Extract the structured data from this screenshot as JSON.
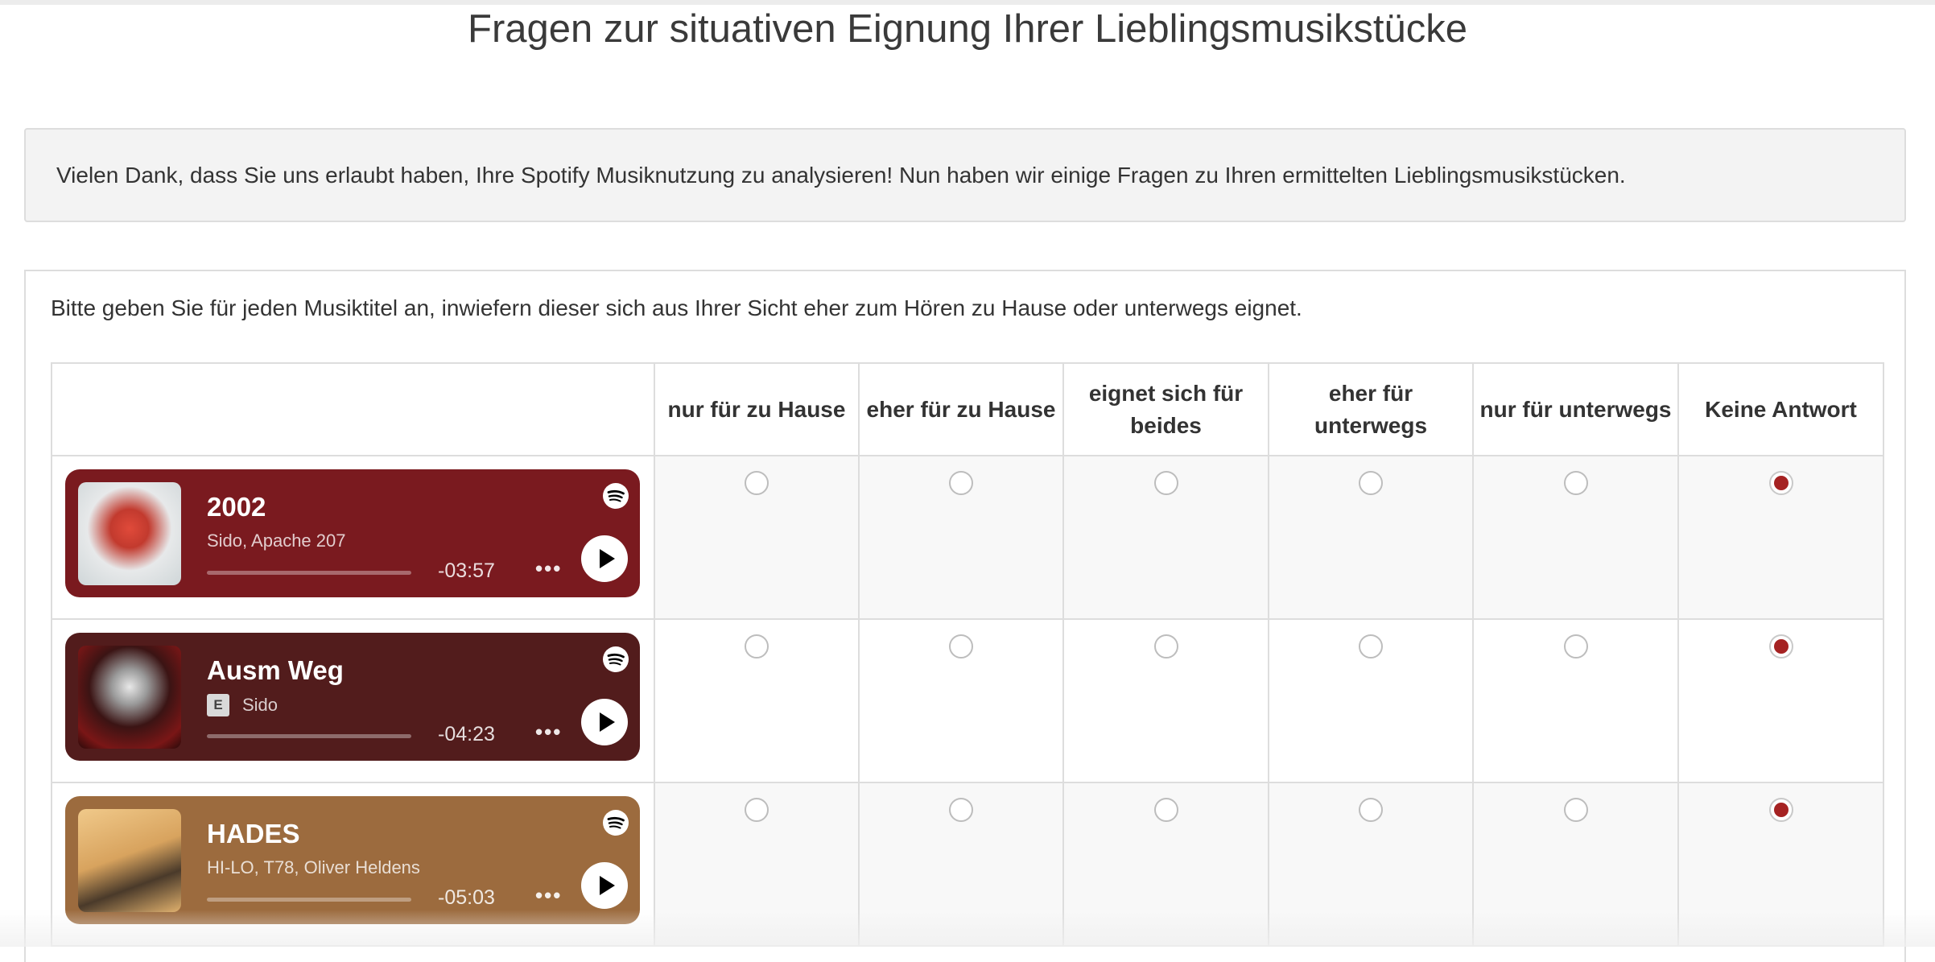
{
  "page": {
    "title": "Fragen zur situativen Eignung Ihrer Lieblingsmusikstücke",
    "intro": "Vielen Dank, dass Sie uns erlaubt haben, Ihre Spotify Musiknutzung zu analysieren! Nun haben wir einige Fragen zu Ihren ermittelten Lieblingsmusikstücken."
  },
  "question": {
    "text": "Bitte geben Sie für jeden Musiktitel an, inwiefern dieser sich aus Ihrer Sicht eher zum Hören zu Hause oder unterwegs eignet.",
    "columns": [
      "nur für zu Hause",
      "eher für zu Hause",
      "eignet sich für beides",
      "eher für unterwegs",
      "nur für unterwegs",
      "Keine Antwort"
    ],
    "rows": [
      {
        "title": "2002",
        "artist": "Sido, Apache 207",
        "explicit": "",
        "time": "-03:57",
        "progress": 0.0,
        "color": "#7a1a1f",
        "selected_index": 5
      },
      {
        "title": "Ausm Weg",
        "artist": "Sido",
        "explicit": "E",
        "time": "-04:23",
        "progress": 0.0,
        "color": "#521c1c",
        "selected_index": 5
      },
      {
        "title": "HADES",
        "artist": "HI-LO, T78, Oliver Heldens",
        "explicit": "",
        "time": "-05:03",
        "progress": 0.0,
        "color": "#9c6b3e",
        "selected_index": 5
      }
    ]
  },
  "icons": {
    "spotify": "spotify-logo-icon",
    "play": "play-icon",
    "more": "more-options-icon"
  },
  "colors": {
    "radio_selected": "#a52222",
    "border": "#dddddd"
  }
}
